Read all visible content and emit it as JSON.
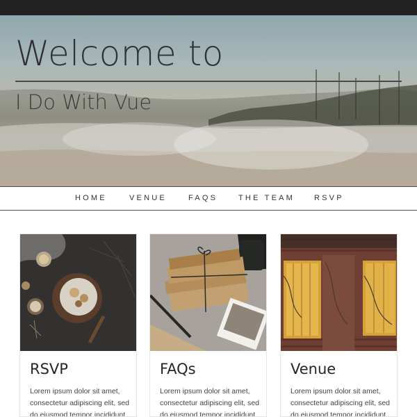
{
  "hero": {
    "title": "Welcome to",
    "subtitle": "I Do With Vue"
  },
  "nav": {
    "items": [
      "HOME",
      "VENUE",
      "FAQS",
      "THE TEAM",
      "RSVP"
    ]
  },
  "cards": [
    {
      "title": "RSVP",
      "text": "Lorem ipsum dolor sit amet, consectetur adipiscing elit, sed do eiusmod tempor incididunt ut",
      "image": "cake-on-wooden-table-photo"
    },
    {
      "title": "FAQs",
      "text": "Lorem ipsum dolor sit amet, consectetur adipiscing elit, sed do eiusmod tempor incididunt ut",
      "image": "tied-letters-and-pen-photo"
    },
    {
      "title": "Venue",
      "text": "Lorem ipsum dolor sit amet, consectetur adipiscing elit, sed do eiusmod tempor incididunt ut",
      "image": "brick-wall-window-shutters-photo"
    }
  ]
}
